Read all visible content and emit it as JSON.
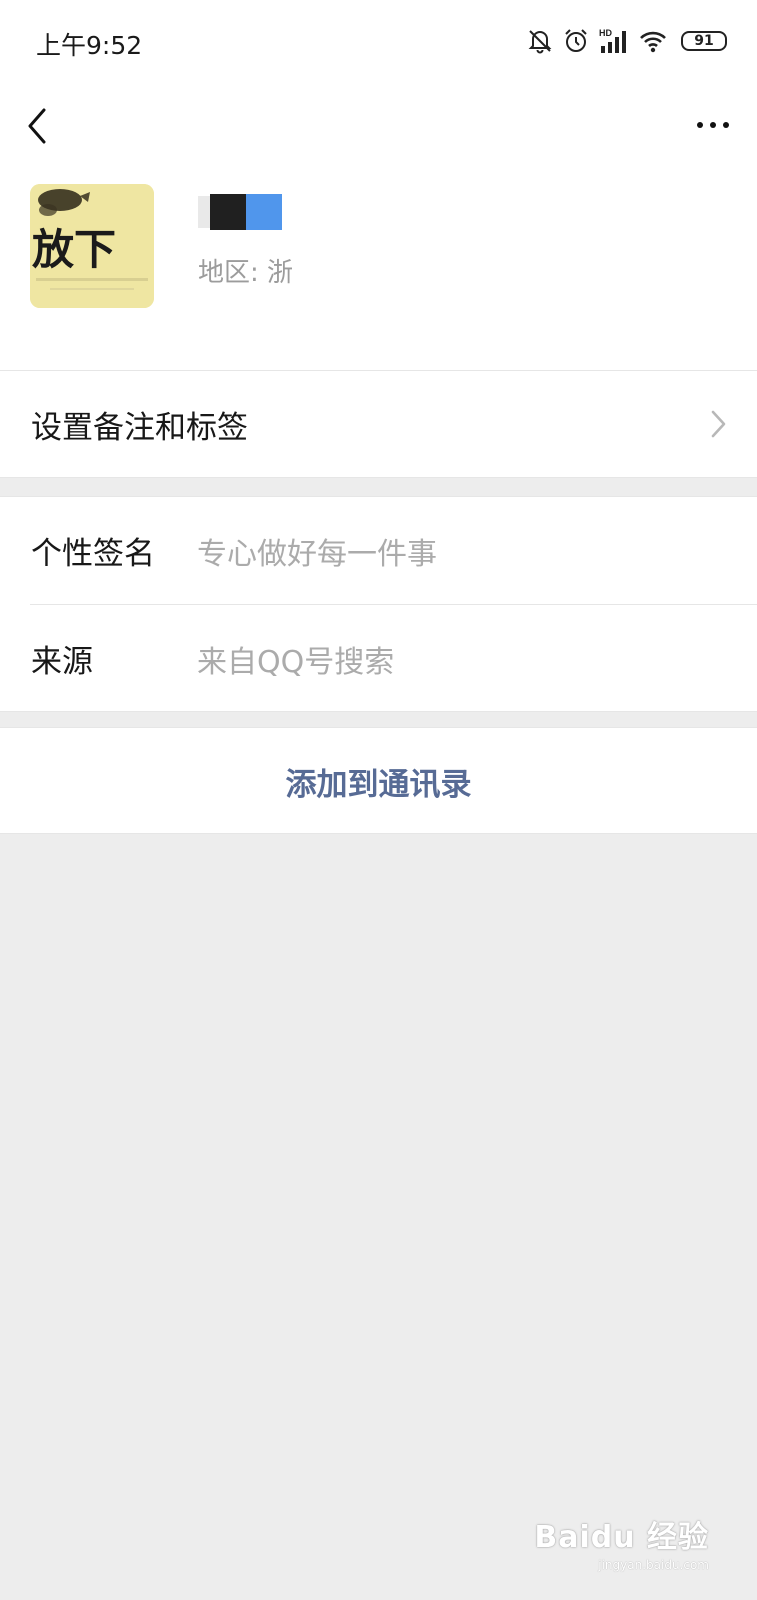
{
  "status_bar": {
    "time": "上午9:52",
    "network": "HD",
    "battery": "91"
  },
  "nav": {
    "back_icon": "chevron-left-icon",
    "more_icon": "more-dots-icon"
  },
  "profile": {
    "avatar_text": "放下",
    "region": "地区: 浙"
  },
  "cells": {
    "remark_label": "设置备注和标签",
    "signature_label": "个性签名",
    "signature_value": "专心做好每一件事",
    "source_label": "来源",
    "source_value": "来自QQ号搜索"
  },
  "action": {
    "add_contact": "添加到通讯录"
  },
  "watermark": {
    "main": "Baidu 经验",
    "sub": "jingyan.baidu.com"
  },
  "colors": {
    "link": "#576b95",
    "background": "#ededed",
    "placeholder": "#ababab"
  }
}
